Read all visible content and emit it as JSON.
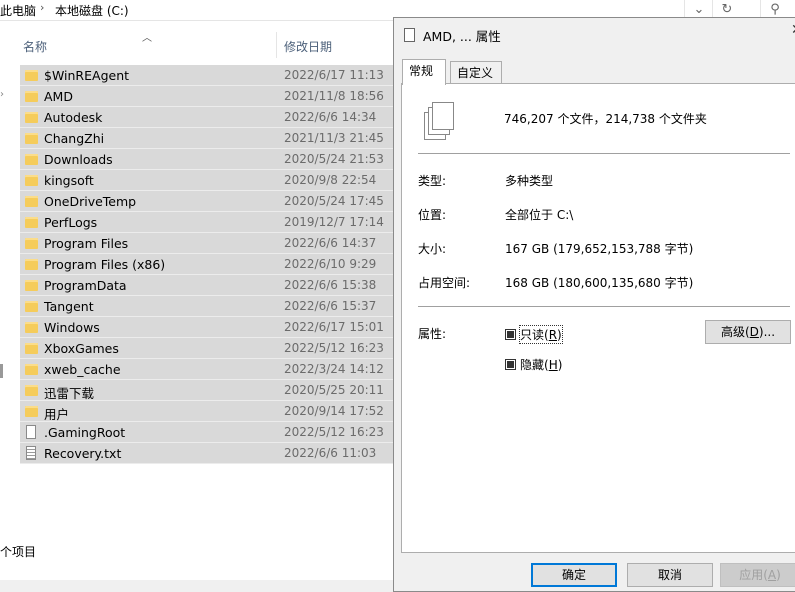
{
  "addressbar": {
    "crumb_1": "此电脑",
    "crumb_2": "本地磁盘 (C:)"
  },
  "explorer": {
    "headers": {
      "name": "名称",
      "modified": "修改日期"
    },
    "rows": [
      {
        "name": "$WinREAgent",
        "date": "2022/6/17 11:13",
        "type": "folder"
      },
      {
        "name": "AMD",
        "date": "2021/11/8 18:56",
        "type": "folder"
      },
      {
        "name": "Autodesk",
        "date": "2022/6/6 14:34",
        "type": "folder"
      },
      {
        "name": "ChangZhi",
        "date": "2021/11/3 21:45",
        "type": "folder"
      },
      {
        "name": "Downloads",
        "date": "2020/5/24 21:53",
        "type": "folder"
      },
      {
        "name": "kingsoft",
        "date": "2020/9/8 22:54",
        "type": "folder"
      },
      {
        "name": "OneDriveTemp",
        "date": "2020/5/24 17:45",
        "type": "folder"
      },
      {
        "name": "PerfLogs",
        "date": "2019/12/7 17:14",
        "type": "folder"
      },
      {
        "name": "Program Files",
        "date": "2022/6/6 14:37",
        "type": "folder"
      },
      {
        "name": "Program Files (x86)",
        "date": "2022/6/10 9:29",
        "type": "folder"
      },
      {
        "name": "ProgramData",
        "date": "2022/6/6 15:38",
        "type": "folder"
      },
      {
        "name": "Tangent",
        "date": "2022/6/6 15:37",
        "type": "folder"
      },
      {
        "name": "Windows",
        "date": "2022/6/17 15:01",
        "type": "folder"
      },
      {
        "name": "XboxGames",
        "date": "2022/5/12 16:23",
        "type": "folder"
      },
      {
        "name": "xweb_cache",
        "date": "2022/3/24 14:12",
        "type": "folder"
      },
      {
        "name": "迅雷下载",
        "date": "2020/5/25 20:11",
        "type": "folder"
      },
      {
        "name": "用户",
        "date": "2020/9/14 17:52",
        "type": "folder"
      },
      {
        "name": ".GamingRoot",
        "date": "2022/5/12 16:23",
        "type": "file"
      },
      {
        "name": "Recovery.txt",
        "date": "2022/6/6 11:03",
        "type": "text"
      }
    ],
    "status": "个项目"
  },
  "dialog": {
    "title": "AMD, ... 属性",
    "tabs": [
      "常规",
      "自定义"
    ],
    "file_count": "746,207 个文件，214,738 个文件夹",
    "props": {
      "type_label": "类型:",
      "type_value": "多种类型",
      "location_label": "位置:",
      "location_value": "全部位于 C:\\",
      "size_label": "大小:",
      "size_value": "167 GB (179,652,153,788 字节)",
      "disk_label": "占用空间:",
      "disk_value": "168 GB (180,600,135,680 字节)",
      "attr_label": "属性:"
    },
    "attributes": {
      "readonly_text": "只读(",
      "readonly_key": "R",
      "readonly_tail": ")",
      "hidden_text": "隐藏(",
      "hidden_key": "H",
      "hidden_tail": ")",
      "advanced_text": "高级(",
      "advanced_key": "D",
      "advanced_tail": ")..."
    },
    "buttons": {
      "ok": "确定",
      "cancel": "取消",
      "apply_text": "应用(",
      "apply_key": "A",
      "apply_tail": ")"
    }
  },
  "colors": {
    "selection": "#d9d9d9",
    "folder": "#f5cc5b",
    "header_text": "#4c607a",
    "primary_border": "#0078d7"
  },
  "icons": [
    "folder-icon",
    "file-icon",
    "text-file-icon",
    "chevron-down-icon",
    "refresh-icon",
    "search-icon",
    "close-icon",
    "multiple-files-icon"
  ]
}
